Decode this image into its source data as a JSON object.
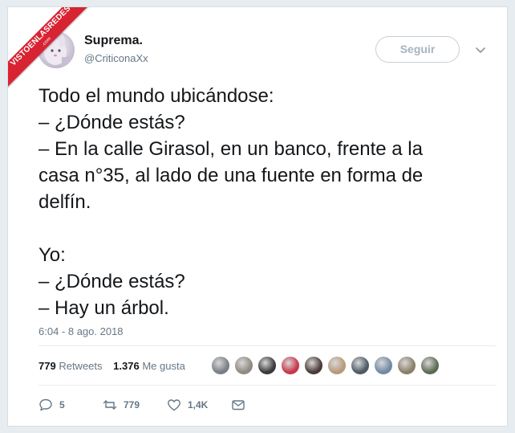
{
  "watermark": {
    "main": "VISTOENLASREDES",
    "sub": ".com"
  },
  "author": {
    "name": "Suprema.",
    "handle": "@CriticonaXx"
  },
  "follow_button": {
    "label": "Seguir"
  },
  "tweet": {
    "lines": [
      "Todo el mundo ubicándose:",
      "– ¿Dónde estás?",
      "– En la calle Girasol, en un banco, frente a la",
      "casa n°35, al lado de una fuente en forma de",
      "delfín.",
      "",
      "Yo:",
      "– ¿Dónde estás?",
      "– Hay un árbol."
    ],
    "timestamp": "6:04 - 8 ago. 2018"
  },
  "stats": {
    "retweets_count": "779",
    "retweets_label": "Retweets",
    "likes_count": "1.376",
    "likes_label": "Me gusta"
  },
  "liker_avatars": [
    {
      "color": "#7a7f86"
    },
    {
      "color": "#8e8a80"
    },
    {
      "color": "#3a3a3e"
    },
    {
      "color": "#c8374a"
    },
    {
      "color": "#4a3b36"
    },
    {
      "color": "#b89a7a"
    },
    {
      "color": "#4e5a66"
    },
    {
      "color": "#6f8aa3"
    },
    {
      "color": "#8a7f6a"
    },
    {
      "color": "#5e6b52"
    }
  ],
  "actions": {
    "reply_count": "5",
    "retweet_count": "779",
    "like_count": "1,4K"
  },
  "colors": {
    "text_primary": "#14171a",
    "text_secondary": "#657786",
    "ribbon": "#d72332",
    "background": "#e6ecf0"
  }
}
